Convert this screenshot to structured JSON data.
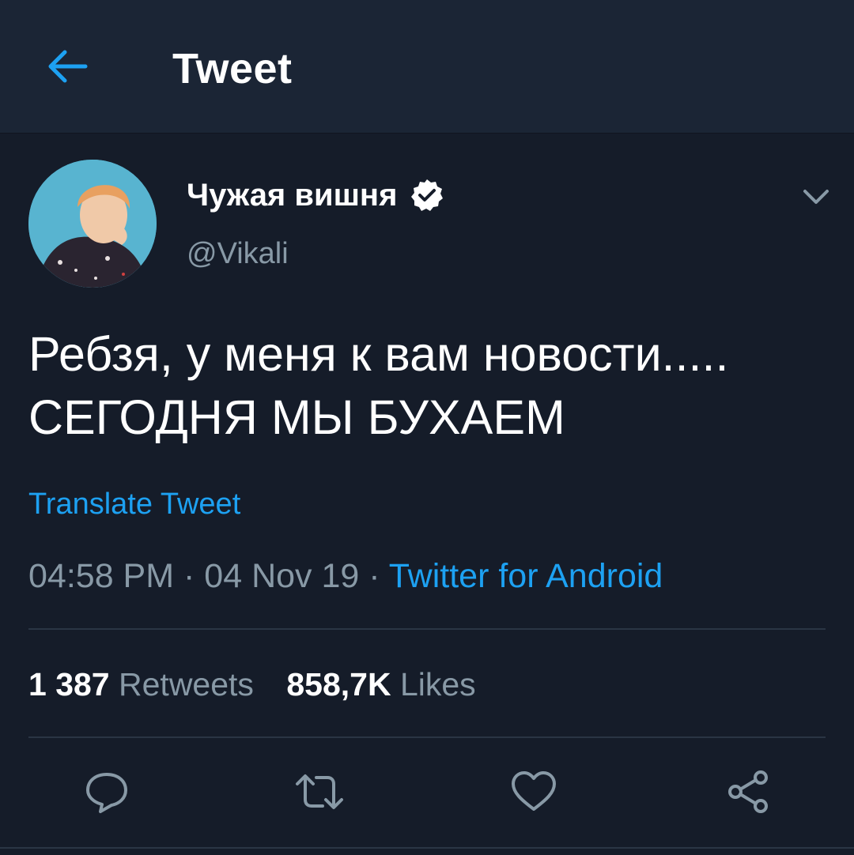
{
  "header": {
    "title": "Tweet",
    "back_icon": "arrow-left-icon"
  },
  "tweet": {
    "author": {
      "display_name": "Чужая вишня",
      "handle": "@Vikali",
      "verified": true
    },
    "text_line1": "Ребзя, у меня к вам новости.....",
    "text_line2": "СЕГОДНЯ МЫ БУХАЕМ",
    "translate_label": "Translate Tweet",
    "time": "04:58 PM",
    "date": "04 Nov 19",
    "separator": "·",
    "client": "Twitter for Android",
    "retweets_count": "1 387",
    "retweets_label": "Retweets",
    "likes_count": "858,7K",
    "likes_label": "Likes"
  },
  "actions": [
    "reply-icon",
    "retweet-icon",
    "like-icon",
    "share-icon"
  ],
  "colors": {
    "background": "#151c29",
    "header": "#1b2535",
    "accent": "#1da1f2",
    "muted": "#8899a6"
  }
}
